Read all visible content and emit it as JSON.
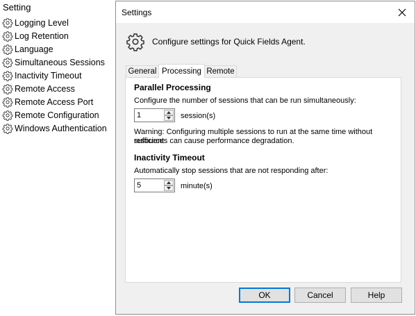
{
  "left_panel": {
    "title": "Setting",
    "items": [
      {
        "label": "Logging Level",
        "icon": "gear-icon"
      },
      {
        "label": "Log Retention",
        "icon": "gear-icon"
      },
      {
        "label": "Language",
        "icon": "gear-icon"
      },
      {
        "label": "Simultaneous Sessions",
        "icon": "gear-icon"
      },
      {
        "label": "Inactivity Timeout",
        "icon": "gear-icon"
      },
      {
        "label": "Remote Access",
        "icon": "gear-icon"
      },
      {
        "label": "Remote Access Port",
        "icon": "gear-icon"
      },
      {
        "label": "Remote Configuration",
        "icon": "gear-icon"
      },
      {
        "label": "Windows Authentication",
        "icon": "gear-icon"
      }
    ]
  },
  "dialog": {
    "title": "Settings",
    "close_icon": "close-icon",
    "header_text": "Configure settings for Quick Fields Agent.",
    "tabs": [
      {
        "label": "General",
        "active": false
      },
      {
        "label": "Processing",
        "active": true
      },
      {
        "label": "Remote",
        "active": false
      }
    ],
    "parallel": {
      "heading": "Parallel Processing",
      "description": "Configure the number of sessions that can be run simultaneously:",
      "value": "1",
      "unit": "session(s)",
      "warning_line1": "Warning: Configuring multiple sessions to run at the same time without sufficient",
      "warning_line2": "resources can cause performance degradation."
    },
    "inactivity": {
      "heading": "Inactivity Timeout",
      "description": "Automatically stop sessions that are not responding after:",
      "value": "5",
      "unit": "minute(s)"
    },
    "buttons": {
      "ok": "OK",
      "cancel": "Cancel",
      "help": "Help"
    }
  },
  "colors": {
    "accent": "#0078d7",
    "dialog_bg": "#f0f0f0",
    "border": "#8c8c8c"
  }
}
